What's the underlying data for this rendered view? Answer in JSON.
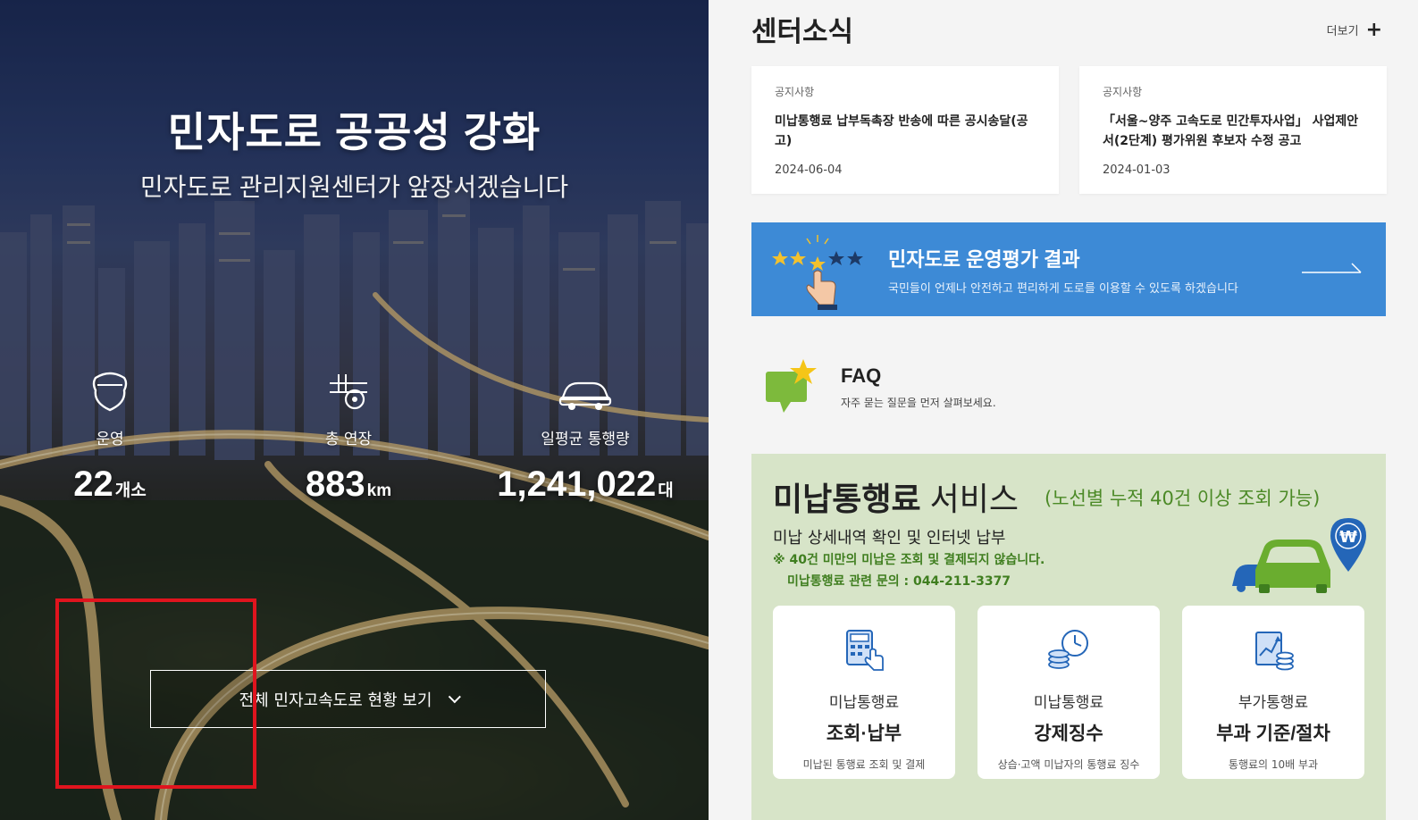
{
  "hero": {
    "title": "민자도로 공공성 강화",
    "subtitle": "민자도로 관리지원센터가 앞장서겠습니다",
    "stats": [
      {
        "icon": "highway-shield-icon",
        "label": "운영",
        "value": "22",
        "unit": "개소"
      },
      {
        "icon": "road-length-icon",
        "label": "총 연장",
        "value": "883",
        "unit": "km"
      },
      {
        "icon": "car-icon",
        "label": "일평균 통행량",
        "value": "1,241,022",
        "unit": "대"
      }
    ],
    "button_label": "전체 민자고속도로 현황 보기"
  },
  "news": {
    "title": "센터소식",
    "more_label": "더보기",
    "items": [
      {
        "category": "공지사항",
        "title": "미납통행료 납부독촉장 반송에 따른 공시송달(공고)",
        "date": "2024-06-04"
      },
      {
        "category": "공지사항",
        "title": "「서울~양주 고속도로 민간투자사업」 사업제안서(2단계) 평가위원 후보자 수정 공고",
        "date": "2024-01-03"
      }
    ]
  },
  "banner": {
    "title": "민자도로 운영평가 결과",
    "subtitle": "국민들이 언제나 안전하고 편리하게 도로를 이용할 수 있도록 하겠습니다"
  },
  "faq": {
    "title": "FAQ",
    "subtitle": "자주 묻는 질문을 먼저 살펴보세요."
  },
  "unpaid": {
    "title_bold": "미납통행료",
    "title_rest": " 서비스",
    "note": "(노선별 누적 40건 이상 조회 가능)",
    "desc": "미납 상세내역 확인 및 인터넷 납부",
    "warn1": "※ 40건 미만의 미납은 조회 및 결제되지 않습니다.",
    "warn2": "미납통행료 관련 문의 : 044-211-3377",
    "won_symbol": "₩",
    "services": [
      {
        "line1": "미납통행료",
        "line2": "조회·납부",
        "line3": "미납된 통행료 조회 및 결제"
      },
      {
        "line1": "미납통행료",
        "line2": "강제징수",
        "line3": "상습·고액 미납자의 통행료 징수"
      },
      {
        "line1": "부가통행료",
        "line2": "부과 기준/절차",
        "line3": "통행료의 10배 부과"
      }
    ]
  },
  "colors": {
    "banner_blue": "#3d8ad6",
    "unpaid_bg": "#d7e4c8",
    "green_text": "#3f7e1f",
    "highlight_red": "#e0141e"
  }
}
